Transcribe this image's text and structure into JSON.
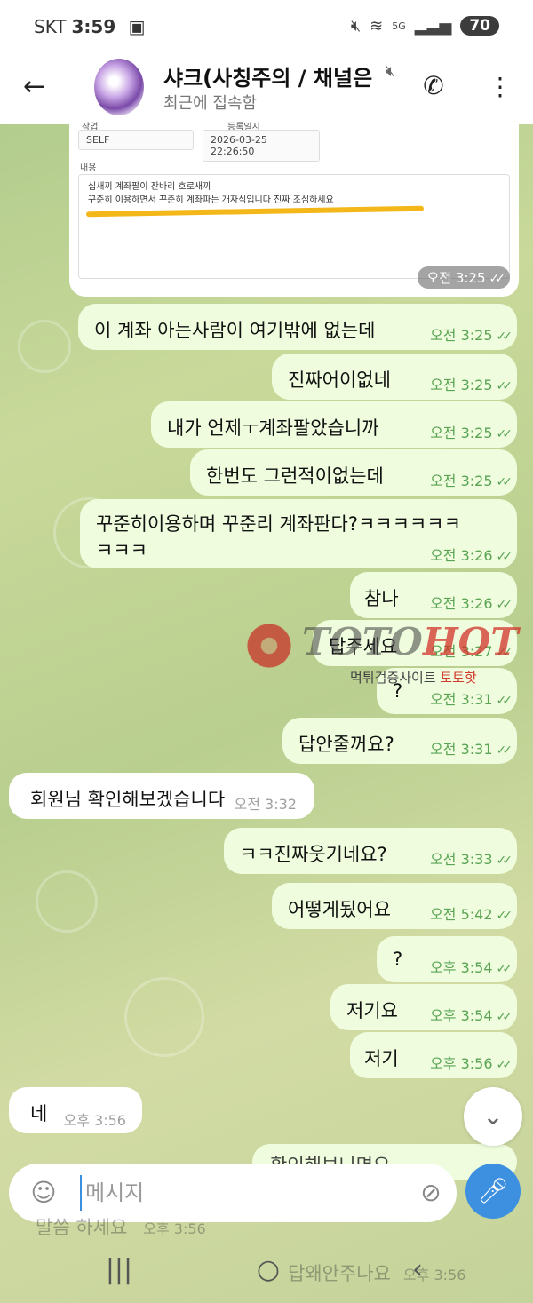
{
  "status_bar": {
    "carrier": "SKT",
    "time": "3:59",
    "network": "5G",
    "battery": "70"
  },
  "header": {
    "title": "샤크(사칭주의 / 채널은",
    "subtitle": "최근에 접속함"
  },
  "screenshot_card": {
    "field_left_label": "작업",
    "field_left_value": "SELF",
    "field_right_label": "등록일시",
    "field_right_value": "2026-03-25 22:26:50",
    "content_label": "내용",
    "content_line1": "십새끼 계좌팔이 잔바리 호로새끼",
    "content_line2": "꾸준히 이용하면서 꾸준히 계좌파는 개자식입니다 진짜 조심하세요",
    "time": "오전 3:25"
  },
  "messages": [
    {
      "dir": "out",
      "text": "이 계좌 아는사람이 여기밖에 없는데",
      "time": "오전 3:25"
    },
    {
      "dir": "out",
      "text": "진짜어이없네",
      "time": "오전 3:25"
    },
    {
      "dir": "out",
      "text": "내가 언제ㅜ계좌팔았습니까",
      "time": "오전 3:25"
    },
    {
      "dir": "out",
      "text": "한번도 그런적이없는데",
      "time": "오전 3:25"
    },
    {
      "dir": "out",
      "text": "꾸준히이용하며 꾸준리 계좌판다?ㅋㅋㅋㅋㅋㅋ",
      "text2": "ㅋㅋㅋ",
      "time": "오전 3:26"
    },
    {
      "dir": "out",
      "text": "참나",
      "time": "오전 3:26"
    },
    {
      "dir": "out",
      "text": "답주세요",
      "time": "오전 3:27"
    },
    {
      "dir": "out",
      "text": "?",
      "time": "오전 3:31"
    },
    {
      "dir": "out",
      "text": "답안줄꺼요?",
      "time": "오전 3:31"
    },
    {
      "dir": "in",
      "text": "회원님 확인해보겠습니다",
      "time": "오전 3:32"
    },
    {
      "dir": "out",
      "text": "ㅋㅋ진짜웃기네요?",
      "time": "오전 3:33"
    },
    {
      "dir": "out",
      "text": "어떻게됬어요",
      "time": "오전 5:42"
    },
    {
      "dir": "out",
      "text": "?",
      "time": "오후 3:54"
    },
    {
      "dir": "out",
      "text": "저기요",
      "time": "오후 3:54"
    },
    {
      "dir": "out",
      "text": "저기",
      "time": "오후 3:56"
    },
    {
      "dir": "in",
      "text": "네",
      "time": "오후 3:56"
    }
  ],
  "hidden_messages": {
    "partial_out": "확인해보니면요",
    "partial_in": "말씀 하세요",
    "partial_in_time": "오후 3:56",
    "partial_nav": "답왜안주나요",
    "partial_nav_time": "오후 3:56"
  },
  "watermark": {
    "brand_left": "TOTO",
    "brand_right": "HOT",
    "sub_prefix": "먹튀검증사이트 ",
    "sub_brand": "토토핫"
  },
  "input": {
    "placeholder": "메시지"
  },
  "icons": {
    "back": "arrow-left-icon",
    "call": "phone-icon",
    "menu": "more-vertical-icon",
    "sticker": "sticker-icon",
    "attach": "paperclip-icon",
    "mic": "microphone-icon",
    "scroll": "chevron-down-icon"
  },
  "colors": {
    "outgoing_bubble": "#effdde",
    "incoming_bubble": "#ffffff",
    "tick_green": "#5aa454",
    "accent_blue": "#3d8fe0"
  }
}
